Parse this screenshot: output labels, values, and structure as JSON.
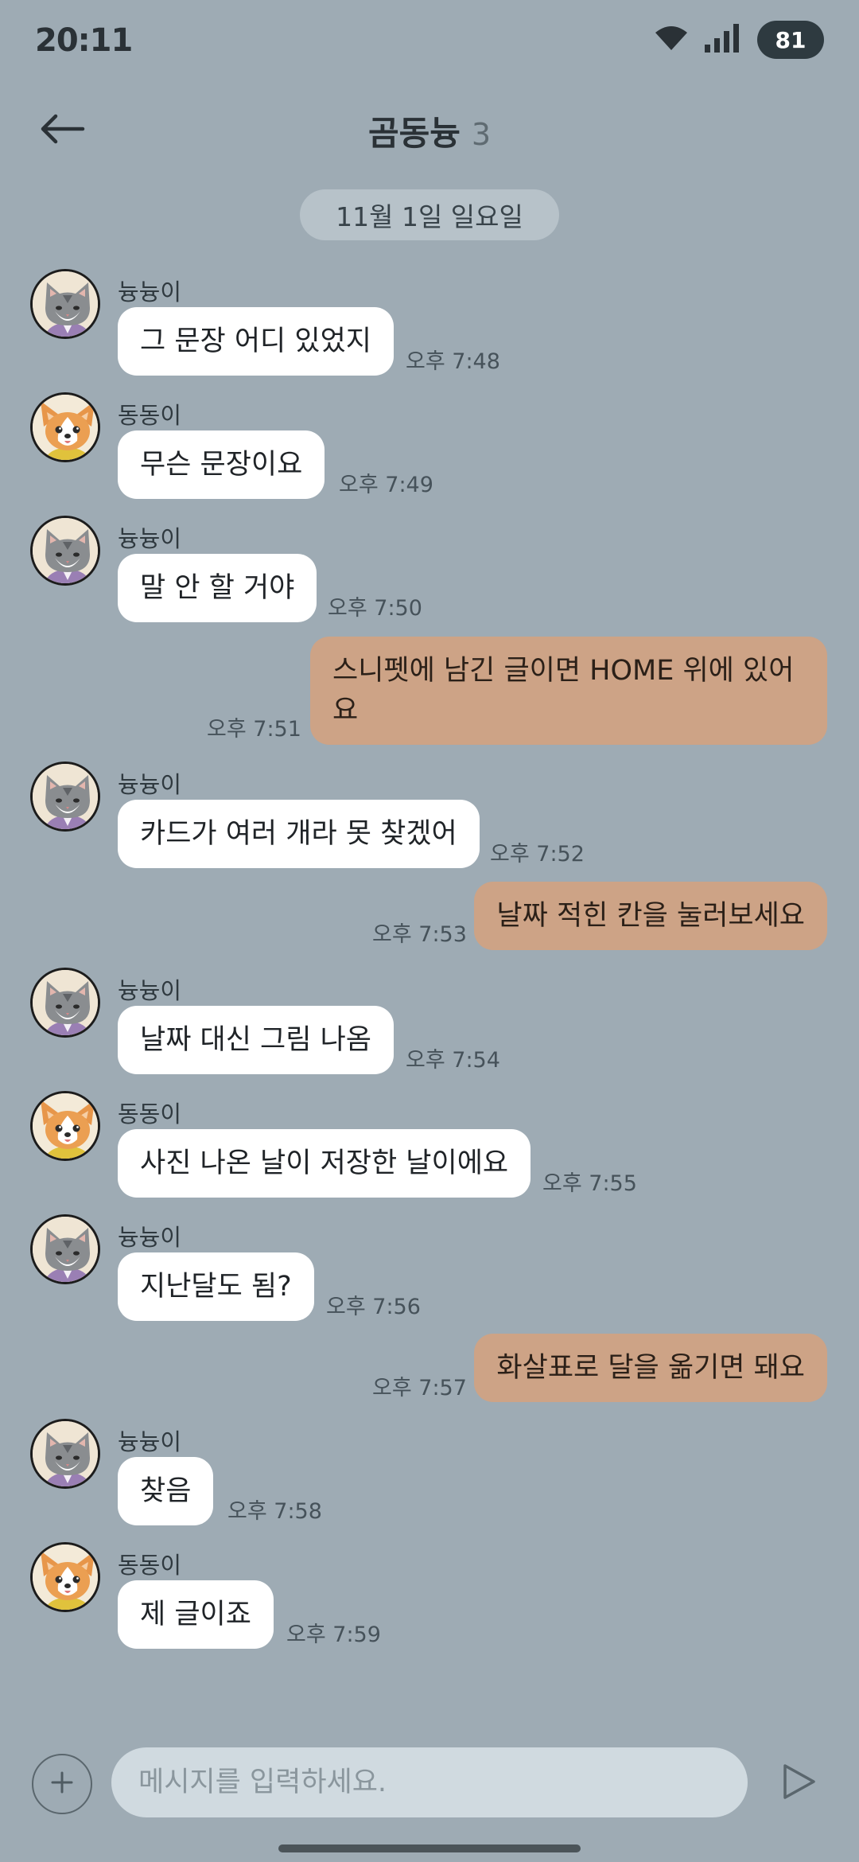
{
  "status_bar": {
    "time": "20:11",
    "battery": "81"
  },
  "header": {
    "title": "곰동늉",
    "member_count": "3"
  },
  "date_divider": "11월 1일 일요일",
  "messages": [
    {
      "sender": "늉늉이",
      "avatar": "cat",
      "text": "그 문장 어디 있었지",
      "time": "오후 7:48"
    },
    {
      "sender": "동동이",
      "avatar": "dog",
      "text": "무슨 문장이요",
      "time": "오후 7:49"
    },
    {
      "sender": "늉늉이",
      "avatar": "cat",
      "text": "말 안 할 거야",
      "time": "오후 7:50"
    },
    {
      "sender": "",
      "avatar": "",
      "text": "스니펫에 남긴 글이면 HOME 위에 있어요",
      "time": "오후 7:51"
    },
    {
      "sender": "늉늉이",
      "avatar": "cat",
      "text": "카드가 여러 개라 못 찾겠어",
      "time": "오후 7:52"
    },
    {
      "sender": "",
      "avatar": "",
      "text": "날짜 적힌 칸을 눌러보세요",
      "time": "오후 7:53"
    },
    {
      "sender": "늉늉이",
      "avatar": "cat",
      "text": "날짜 대신 그림 나옴",
      "time": "오후 7:54"
    },
    {
      "sender": "동동이",
      "avatar": "dog",
      "text": "사진 나온 날이 저장한 날이에요",
      "time": "오후 7:55"
    },
    {
      "sender": "늉늉이",
      "avatar": "cat",
      "text": "지난달도 됨?",
      "time": "오후 7:56"
    },
    {
      "sender": "",
      "avatar": "",
      "text": "화살표로 달을 옮기면 돼요",
      "time": "오후 7:57"
    },
    {
      "sender": "늉늉이",
      "avatar": "cat",
      "text": "찾음",
      "time": "오후 7:58"
    },
    {
      "sender": "동동이",
      "avatar": "dog",
      "text": "제 글이죠",
      "time": "오후 7:59"
    }
  ],
  "input": {
    "placeholder": "메시지를 입력하세요.",
    "value": ""
  },
  "icons": {
    "back": "arrow-left-icon",
    "wifi": "wifi-icon",
    "signal": "signal-icon",
    "add": "plus-icon",
    "send": "send-icon"
  },
  "colors": {
    "background": "#9eabb4",
    "incoming_bubble": "#ffffff",
    "outgoing_bubble": "#cda386",
    "date_pill": "#b7c2c9",
    "input_field": "#d0dae0"
  }
}
